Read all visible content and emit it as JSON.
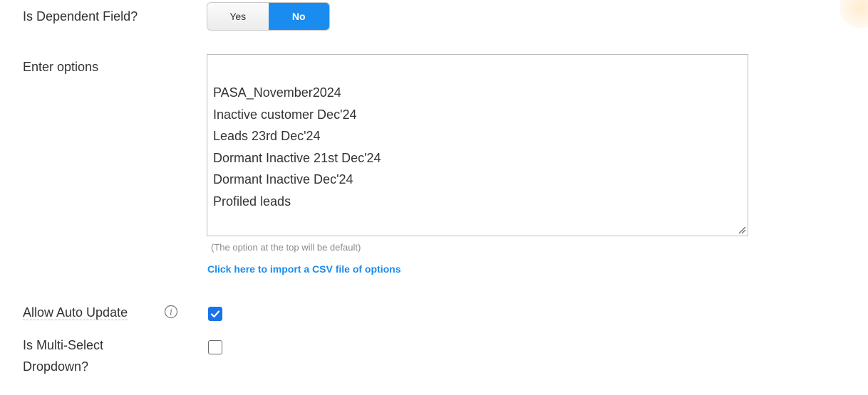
{
  "dependent_field": {
    "label": "Is Dependent Field?",
    "yes_label": "Yes",
    "no_label": "No",
    "selected": "No"
  },
  "options": {
    "label": "Enter options",
    "items": [
      "PASA_November2024",
      "Inactive customer Dec'24",
      "Leads 23rd Dec'24",
      "Dormant Inactive 21st Dec'24",
      "Dormant Inactive Dec'24",
      "Profiled leads"
    ],
    "hint": "(The option at the top will be default)",
    "import_link": "Click here to import a CSV file of options"
  },
  "auto_update": {
    "label": "Allow Auto Update",
    "checked": true,
    "icon": "info-icon"
  },
  "multi_select": {
    "label_line1": "Is Multi-Select",
    "label_line2": "Dropdown?",
    "checked": false
  },
  "colors": {
    "accent": "#1a8cf0",
    "checkbox_checked": "#1a73e8",
    "text": "#333333",
    "hint": "#8a8a8a"
  }
}
